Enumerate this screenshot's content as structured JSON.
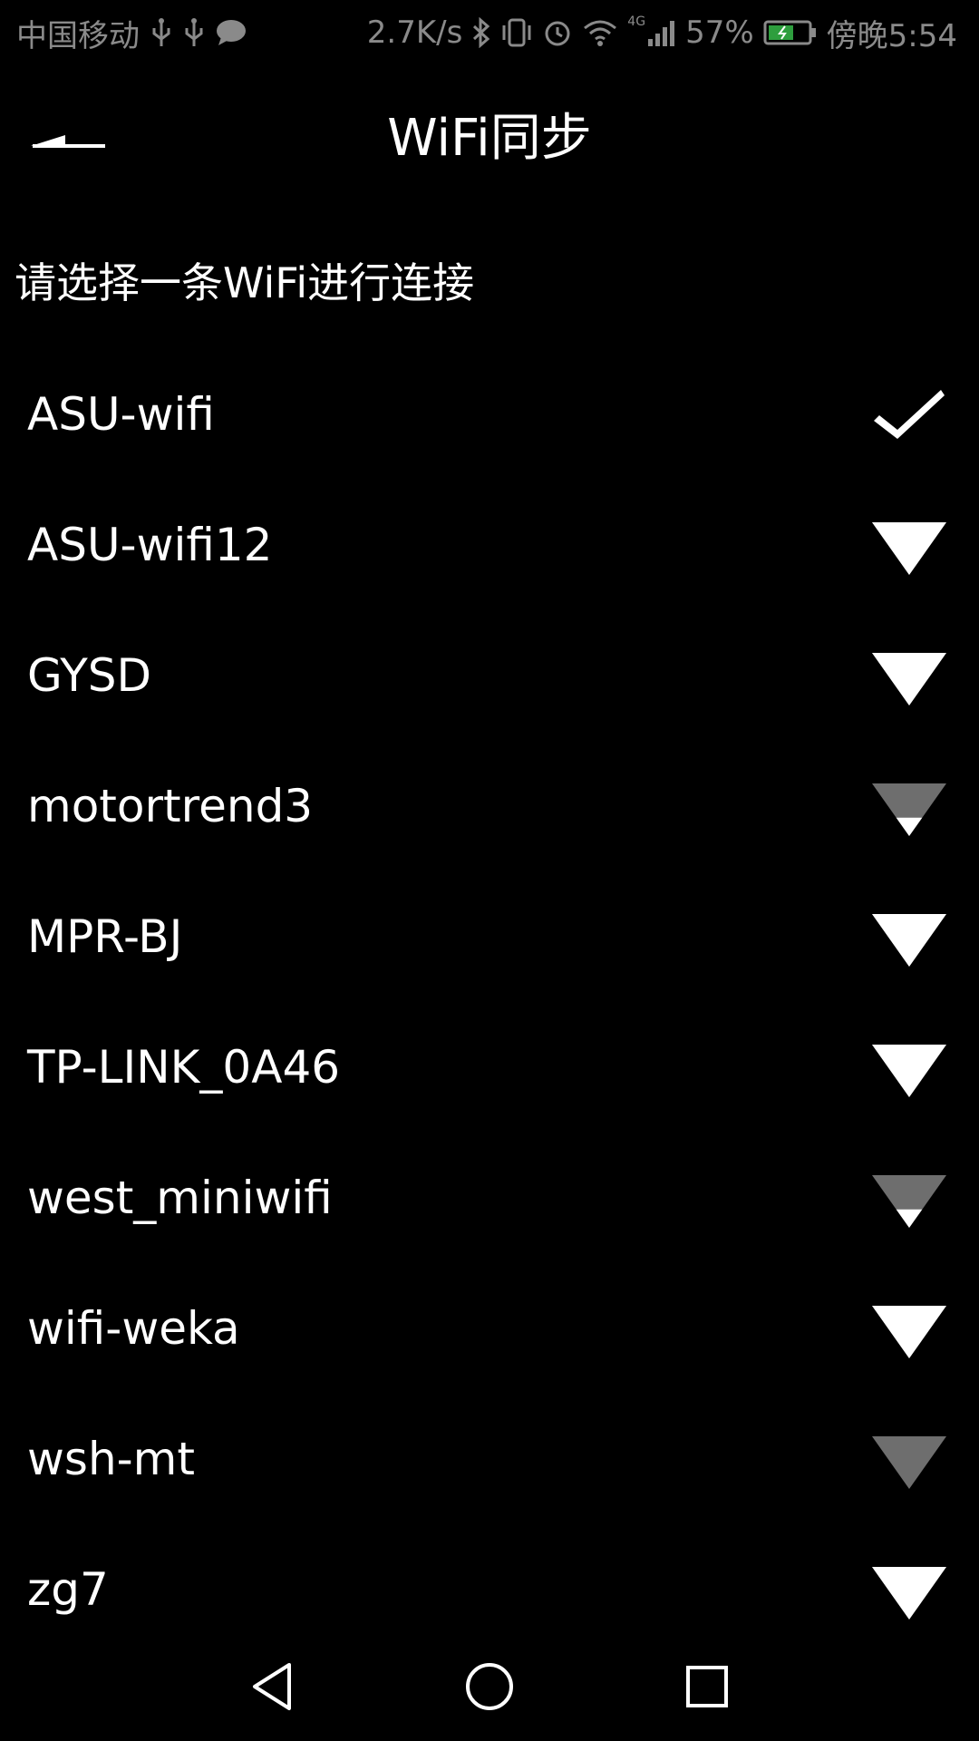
{
  "status_bar": {
    "carrier": "中国移动",
    "net_speed": "2.7K/s",
    "network_type": "4G",
    "battery": "57%",
    "time": "傍晚5:54",
    "left_icons": [
      "usb-icon",
      "usb-icon",
      "message-icon"
    ],
    "right_icons": [
      "bluetooth-icon",
      "vibrate-icon",
      "alarm-icon",
      "wifi-icon",
      "signal-icon",
      "battery-icon"
    ]
  },
  "header": {
    "back_icon": "back-arrow-icon",
    "title": "WiFi同步"
  },
  "instruction": "请选择一条WiFi进行连接",
  "wifi_list": [
    {
      "ssid": "ASU-wifi",
      "indicator": "check-icon",
      "signal": "connected"
    },
    {
      "ssid": "ASU-wifi12",
      "indicator": "wifi-signal-icon",
      "signal_level": 1.0
    },
    {
      "ssid": "GYSD",
      "indicator": "wifi-signal-icon",
      "signal_level": 1.0
    },
    {
      "ssid": "motortrend3",
      "indicator": "wifi-signal-icon",
      "signal_level": 0.35
    },
    {
      "ssid": "MPR-BJ",
      "indicator": "wifi-signal-icon",
      "signal_level": 1.0
    },
    {
      "ssid": "TP-LINK_0A46",
      "indicator": "wifi-signal-icon",
      "signal_level": 1.0
    },
    {
      "ssid": "west_miniwifi",
      "indicator": "wifi-signal-icon",
      "signal_level": 0.35
    },
    {
      "ssid": "wifi-weka",
      "indicator": "wifi-signal-icon",
      "signal_level": 1.0
    },
    {
      "ssid": "wsh-mt",
      "indicator": "wifi-signal-icon",
      "signal_level": 0.0
    },
    {
      "ssid": "zg7",
      "indicator": "wifi-signal-icon",
      "signal_level": 1.0
    }
  ],
  "nav_bar": {
    "buttons": [
      "back-nav-icon",
      "home-nav-icon",
      "recents-nav-icon"
    ]
  },
  "colors": {
    "background": "#000000",
    "text": "#ffffff",
    "status_text": "#8a8a8a",
    "signal_full": "#ffffff",
    "signal_empty": "#6e6e6e",
    "battery_fill": "#2e9e3e"
  }
}
